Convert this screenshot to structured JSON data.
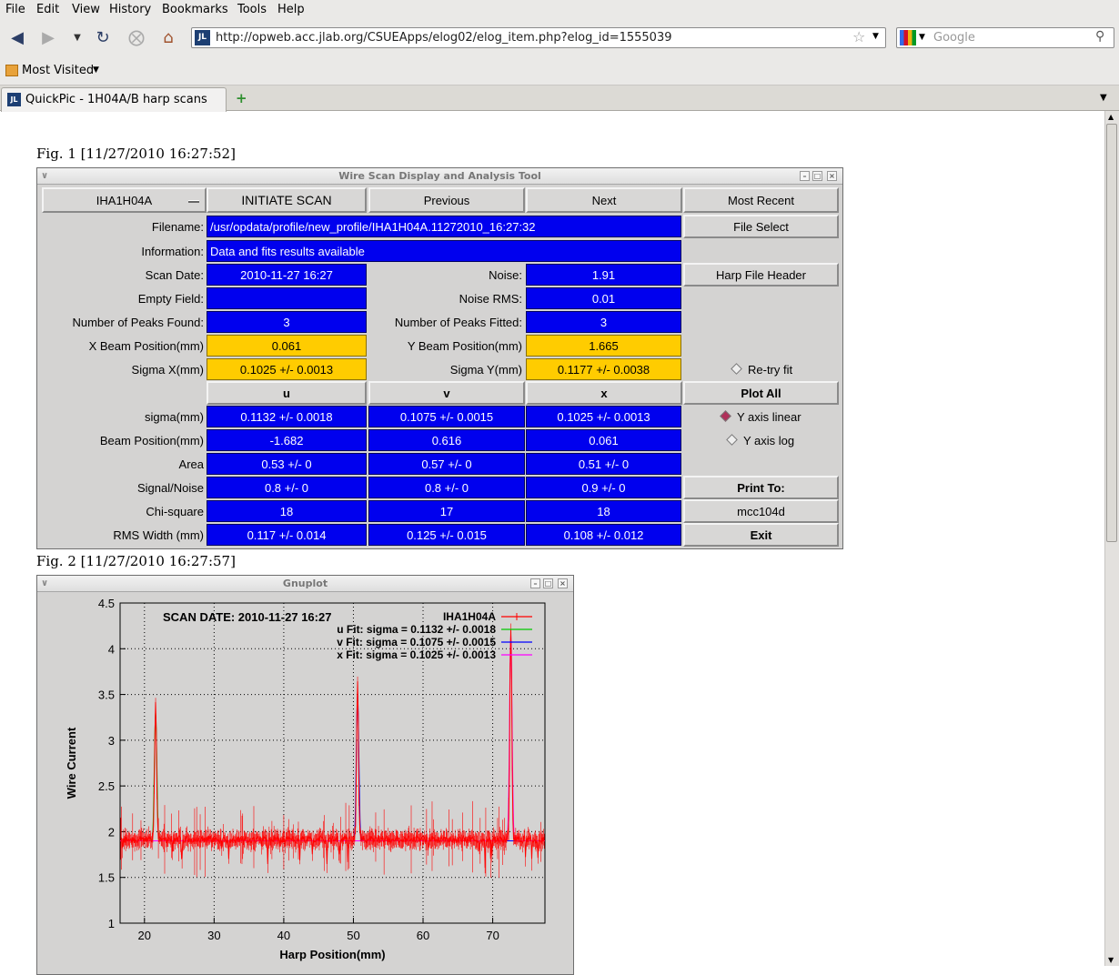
{
  "browser": {
    "menus": [
      "File",
      "Edit",
      "View",
      "History",
      "Bookmarks",
      "Tools",
      "Help"
    ],
    "url": "http://opweb.acc.jlab.org/CSUEApps/elog02/elog_item.php?elog_id=1555039",
    "search_placeholder": "Google",
    "bookmark_label": "Most Visited",
    "tab_title": "QuickPic - 1H04A/B harp scans",
    "favicon_text": "JL"
  },
  "fig1": {
    "label": "Fig. 1 [11/27/2010 16:27:52]",
    "window_title": "Wire Scan Display and Analysis Tool",
    "device": "IHA1H04A",
    "buttons": {
      "initiate": "INITIATE SCAN",
      "previous": "Previous",
      "next": "Next",
      "most_recent": "Most Recent",
      "file_select": "File Select",
      "harp_header": "Harp File Header",
      "plot_all": "Plot All",
      "print_to": "Print To:",
      "printer": "mcc104d",
      "exit": "Exit"
    },
    "labels": {
      "filename": "Filename:",
      "information": "Information:",
      "scan_date": "Scan Date:",
      "noise": "Noise:",
      "empty_field": "Empty Field:",
      "noise_rms": "Noise RMS:",
      "peaks_found": "Number of Peaks Found:",
      "peaks_fitted": "Number of Peaks Fitted:",
      "x_beam": "X Beam Position(mm)",
      "y_beam": "Y Beam Position(mm)",
      "sigma_x": "Sigma X(mm)",
      "sigma_y": "Sigma Y(mm)",
      "retry": "Re-try fit",
      "y_linear": "Y axis linear",
      "y_log": "Y axis log"
    },
    "values": {
      "filename": "/usr/opdata/profile/new_profile/IHA1H04A.11272010_16:27:32",
      "information": "Data and fits results available",
      "scan_date": "2010-11-27   16:27",
      "noise": "1.91",
      "empty_field": "",
      "noise_rms": "0.01",
      "peaks_found": "3",
      "peaks_fitted": "3",
      "x_beam": "0.061",
      "y_beam": "1.665",
      "sigma_x": "0.1025 +/- 0.0013",
      "sigma_y": "0.1177 +/- 0.0038"
    },
    "table": {
      "columns": [
        "u",
        "v",
        "x"
      ],
      "rows": [
        {
          "label": "sigma(mm)",
          "values": [
            "0.1132 +/- 0.0018",
            "0.1075 +/- 0.0015",
            "0.1025 +/- 0.0013"
          ]
        },
        {
          "label": "Beam Position(mm)",
          "values": [
            "-1.682",
            "0.616",
            "0.061"
          ]
        },
        {
          "label": "Area",
          "values": [
            "0.53 +/- 0",
            "0.57 +/- 0",
            "0.51 +/- 0"
          ]
        },
        {
          "label": "Signal/Noise",
          "values": [
            "0.8 +/- 0",
            "0.8 +/- 0",
            "0.9 +/- 0"
          ]
        },
        {
          "label": "Chi-square",
          "values": [
            "18",
            "17",
            "18"
          ]
        },
        {
          "label": "RMS Width (mm)",
          "values": [
            "0.117 +/- 0.014",
            "0.125 +/- 0.015",
            "0.108 +/- 0.012"
          ]
        }
      ]
    }
  },
  "fig2": {
    "label": "Fig. 2 [11/27/2010 16:27:57]",
    "window_title": "Gnuplot"
  },
  "chart_data": {
    "type": "line",
    "title": "",
    "annotation": "SCAN DATE: 2010-11-27   16:27",
    "xlabel": "Harp Position(mm)",
    "ylabel": "Wire Current",
    "xlim": [
      16.5,
      77.5
    ],
    "ylim": [
      1,
      4.5
    ],
    "xticks": [
      20,
      30,
      40,
      50,
      60,
      70
    ],
    "yticks": [
      1,
      1.5,
      2,
      2.5,
      3,
      3.5,
      4,
      4.5
    ],
    "grid": true,
    "legend_position": "top-right",
    "series": [
      {
        "name": "IHA1H04A",
        "color": "#ff0000",
        "baseline": 1.92,
        "peaks": [
          {
            "center": 21.6,
            "height": 3.45
          },
          {
            "center": 50.6,
            "height": 3.65
          },
          {
            "center": 72.6,
            "height": 4.25
          }
        ]
      },
      {
        "name": "u  Fit: sigma = 0.1132 +/- 0.0018",
        "color": "#00c800",
        "center": 21.6,
        "height": 3.3
      },
      {
        "name": "v  Fit: sigma = 0.1075 +/- 0.0015",
        "color": "#0000ff",
        "center": 50.6,
        "height": 3.5
      },
      {
        "name": "x  Fit: sigma = 0.1025 +/- 0.0013",
        "color": "#ff00ff",
        "center": 72.6,
        "height": 4.15
      }
    ]
  }
}
